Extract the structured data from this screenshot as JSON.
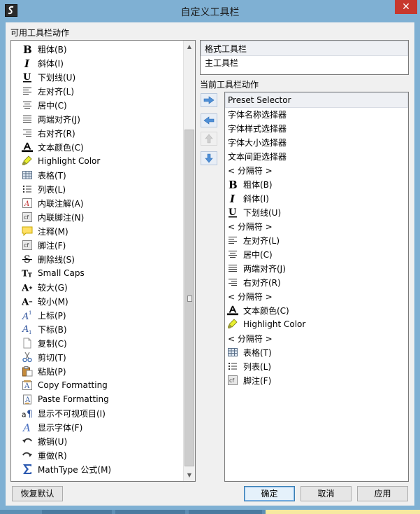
{
  "window": {
    "title": "自定义工具栏",
    "close_glyph": "✕"
  },
  "available": {
    "label": "可用工具栏动作",
    "items": [
      {
        "icon": "bold-icon",
        "label": "粗体(B)"
      },
      {
        "icon": "italic-icon",
        "label": "斜体(I)"
      },
      {
        "icon": "underline-icon",
        "label": "下划线(U)"
      },
      {
        "icon": "align-left-icon",
        "label": "左对齐(L)"
      },
      {
        "icon": "align-center-icon",
        "label": "居中(C)"
      },
      {
        "icon": "align-justify-icon",
        "label": "两端对齐(J)"
      },
      {
        "icon": "align-right-icon",
        "label": "右对齐(R)"
      },
      {
        "icon": "text-color-icon",
        "label": "文本颜色(C)"
      },
      {
        "icon": "highlighter-icon",
        "label": "Highlight Color"
      },
      {
        "icon": "table-icon",
        "label": "表格(T)"
      },
      {
        "icon": "list-icon",
        "label": "列表(L)"
      },
      {
        "icon": "inline-annotation-icon",
        "label": "内联注解(A)"
      },
      {
        "icon": "inline-footnote-icon",
        "label": "内联脚注(N)"
      },
      {
        "icon": "comment-icon",
        "label": "注释(M)"
      },
      {
        "icon": "footnote-icon",
        "label": "脚注(F)"
      },
      {
        "icon": "strikethrough-icon",
        "label": "删除线(S)"
      },
      {
        "icon": "small-caps-icon",
        "label": "Small Caps"
      },
      {
        "icon": "font-bigger-icon",
        "label": "较大(G)"
      },
      {
        "icon": "font-smaller-icon",
        "label": "较小(M)"
      },
      {
        "icon": "superscript-icon",
        "label": "上标(P)"
      },
      {
        "icon": "subscript-icon",
        "label": "下标(B)"
      },
      {
        "icon": "copy-icon",
        "label": "复制(C)"
      },
      {
        "icon": "scissors-icon",
        "label": "剪切(T)"
      },
      {
        "icon": "paste-icon",
        "label": "粘贴(P)"
      },
      {
        "icon": "copy-formatting-icon",
        "label": "Copy Formatting"
      },
      {
        "icon": "paste-formatting-icon",
        "label": "Paste Formatting"
      },
      {
        "icon": "show-invisibles-icon",
        "label": "显示不可视项目(I)"
      },
      {
        "icon": "show-fonts-icon",
        "label": "显示字体(F)"
      },
      {
        "icon": "undo-icon",
        "label": "撤销(U)"
      },
      {
        "icon": "redo-icon",
        "label": "重做(R)"
      },
      {
        "icon": "sigma-icon",
        "label": "MathType 公式(M)"
      }
    ]
  },
  "toolbars": {
    "items": [
      {
        "label": "格式工具栏",
        "selected": true
      },
      {
        "label": "主工具栏",
        "selected": false
      }
    ]
  },
  "current": {
    "label": "当前工具栏动作",
    "items": [
      {
        "icon": "",
        "label": "Preset Selector",
        "selected": true
      },
      {
        "icon": "",
        "label": "字体名称选择器"
      },
      {
        "icon": "",
        "label": "字体样式选择器"
      },
      {
        "icon": "",
        "label": "字体大小选择器"
      },
      {
        "icon": "",
        "label": "文本间距选择器"
      },
      {
        "icon": "",
        "label": "< 分隔符 >"
      },
      {
        "icon": "bold-icon",
        "label": "粗体(B)"
      },
      {
        "icon": "italic-icon",
        "label": "斜体(I)"
      },
      {
        "icon": "underline-icon",
        "label": "下划线(U)"
      },
      {
        "icon": "",
        "label": "< 分隔符 >"
      },
      {
        "icon": "align-left-icon",
        "label": "左对齐(L)"
      },
      {
        "icon": "align-center-icon",
        "label": "居中(C)"
      },
      {
        "icon": "align-justify-icon",
        "label": "两端对齐(J)"
      },
      {
        "icon": "align-right-icon",
        "label": "右对齐(R)"
      },
      {
        "icon": "",
        "label": "< 分隔符 >"
      },
      {
        "icon": "text-color-icon",
        "label": "文本颜色(C)"
      },
      {
        "icon": "highlighter-icon",
        "label": "Highlight Color"
      },
      {
        "icon": "",
        "label": "< 分隔符 >"
      },
      {
        "icon": "table-icon",
        "label": "表格(T)"
      },
      {
        "icon": "list-icon",
        "label": "列表(L)"
      },
      {
        "icon": "footnote-icon",
        "label": "脚注(F)"
      }
    ]
  },
  "move_buttons": [
    {
      "name": "add-action-button",
      "icon": "arrow-right-icon",
      "enabled": true
    },
    {
      "name": "remove-action-button",
      "icon": "arrow-left-icon",
      "enabled": true
    },
    {
      "name": "move-up-button",
      "icon": "arrow-up-icon",
      "enabled": false
    },
    {
      "name": "move-down-button",
      "icon": "arrow-down-icon",
      "enabled": true
    }
  ],
  "buttons": {
    "restore_defaults": "恢复默认",
    "ok": "确定",
    "cancel": "取消",
    "apply": "应用"
  },
  "colors": {
    "titlebar": "#7fb0d3",
    "close": "#c7382d",
    "arrow_blue": "#4f8fd6",
    "text_color_bar": "#000000",
    "highlighter": "#d8e000"
  }
}
